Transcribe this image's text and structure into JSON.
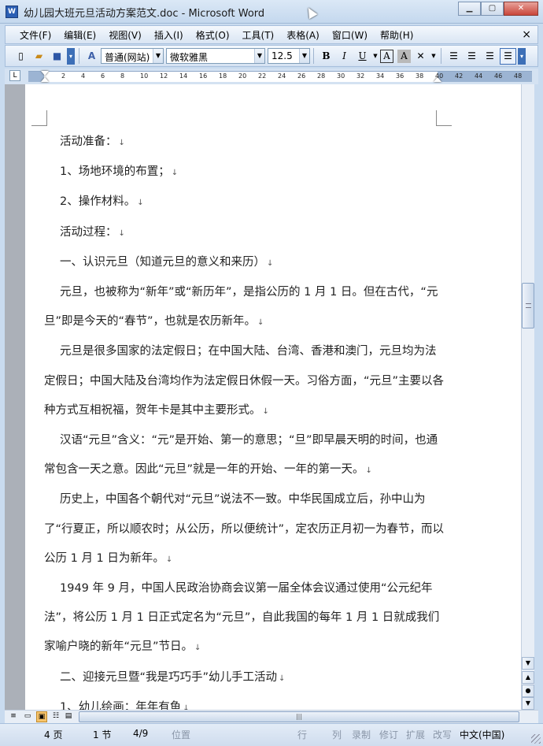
{
  "window": {
    "title": "幼儿园大班元旦活动方案范文.doc - Microsoft Word",
    "app_icon": "W"
  },
  "menu": {
    "items": [
      "文件(F)",
      "编辑(E)",
      "视图(V)",
      "插入(I)",
      "格式(O)",
      "工具(T)",
      "表格(A)",
      "窗口(W)",
      "帮助(H)"
    ],
    "close_label": "×"
  },
  "toolbar": {
    "style": "普通(网站)",
    "font": "微软雅黑",
    "size": "12.5",
    "bold": "B",
    "italic": "I",
    "underline": "U",
    "border_a": "A",
    "shade_a": "A",
    "style_icon": "A"
  },
  "ruler": {
    "ticks": [
      "2",
      "4",
      "6",
      "8",
      "10",
      "12",
      "14",
      "16",
      "18",
      "20",
      "22",
      "24",
      "26",
      "28",
      "30",
      "32",
      "34",
      "36",
      "38",
      "40",
      "42",
      "44",
      "46",
      "48"
    ]
  },
  "document": {
    "paragraphs": [
      {
        "text": "活动准备：",
        "indent": true
      },
      {
        "text": "1、场地环境的布置；",
        "indent": true
      },
      {
        "text": "2、操作材料。",
        "indent": true
      },
      {
        "text": "活动过程：",
        "indent": true
      },
      {
        "text": "一、认识元旦（知道元旦的意义和来历）",
        "indent": true
      },
      {
        "text": "元旦，也被称为“新年”或“新历年”，是指公历的 1 月 1 日。但在古代，“元旦”即是今天的“春节”，也就是农历新年。",
        "indent": true
      },
      {
        "text": "元旦是很多国家的法定假日；在中国大陆、台湾、香港和澳门，元旦均为法定假日；中国大陆及台湾均作为法定假日休假一天。习俗方面，“元旦”主要以各种方式互相祝福，贺年卡是其中主要形式。",
        "indent": true
      },
      {
        "text": "汉语“元旦”含义：“元”是开始、第一的意思；“旦”即早晨天明的时间，也通常包含一天之意。因此“元旦”就是一年的开始、一年的第一天。",
        "indent": true
      },
      {
        "text": "历史上，中国各个朝代对“元旦”说法不一致。中华民国成立后，孙中山为了“行夏正，所以顺农时；从公历，所以便统计”，定农历正月初一为春节，而以公历 1 月 1 日为新年。",
        "indent": true
      },
      {
        "text": "1949 年 9 月，中国人民政治协商会议第一届全体会议通过使用“公元纪年法”，将公历 1 月 1 日正式定名为“元旦”，自此我国的每年 1 月 1 日就成我们家喻户晓的新年“元旦”节日。",
        "indent": true
      },
      {
        "text": "二、迎接元旦暨“我是巧巧手”幼儿手工活动",
        "indent": true
      },
      {
        "text": "1、幼儿绘画：年年有鱼",
        "indent": true
      }
    ],
    "paragraph_mark": "↓"
  },
  "status": {
    "page": "4 页",
    "section": "1 节",
    "page_of": "4/9",
    "position": "位置",
    "line": "行",
    "column": "列",
    "rec": "录制",
    "trk": "修订",
    "ext": "扩展",
    "ovr": "改写",
    "language": "中文(中国)"
  },
  "colors": {
    "chrome": "#c9dbef",
    "page": "#ffffff",
    "workspace": "#abb0b8"
  }
}
